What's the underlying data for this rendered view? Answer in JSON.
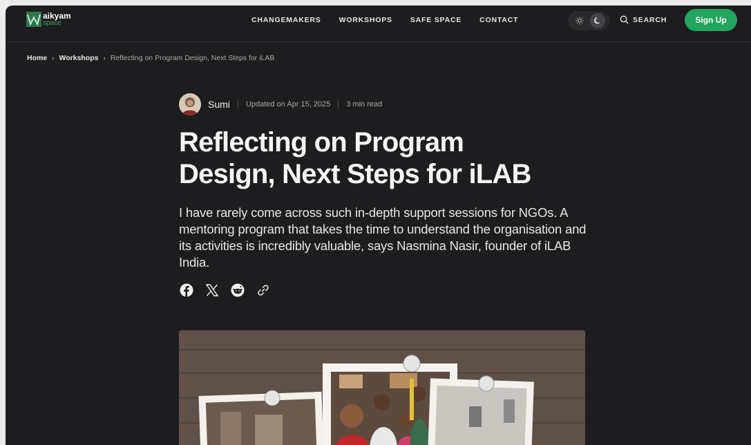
{
  "brand": {
    "line1": "aikyam",
    "line2": "space"
  },
  "nav": {
    "items": [
      "CHANGEMAKERS",
      "WORKSHOPS",
      "SAFE SPACE",
      "CONTACT"
    ],
    "search_label": "SEARCH",
    "signup_label": "Sign Up"
  },
  "breadcrumb": {
    "home": "Home",
    "section": "Workshops",
    "current": "Reflecting on Program Design, Next Steps for iLAB"
  },
  "article": {
    "author": "Sumi",
    "updated": "Updated on Apr 15, 2025",
    "read_time": "3 min read",
    "title_line1": "Reflecting on Program",
    "title_line2": "Design, Next Steps for iLAB",
    "subtitle": "I have rarely come across such in-depth support sessions for NGOs. A mentoring program that takes the time to understand the organisation and its activities is incredibly valuable, says Nasmina Nasir, founder of iLAB India."
  },
  "share_icons": [
    "facebook-icon",
    "x-icon",
    "reddit-icon",
    "link-icon"
  ],
  "colors": {
    "accent": "#22a55c",
    "background": "#1d1d1f"
  }
}
